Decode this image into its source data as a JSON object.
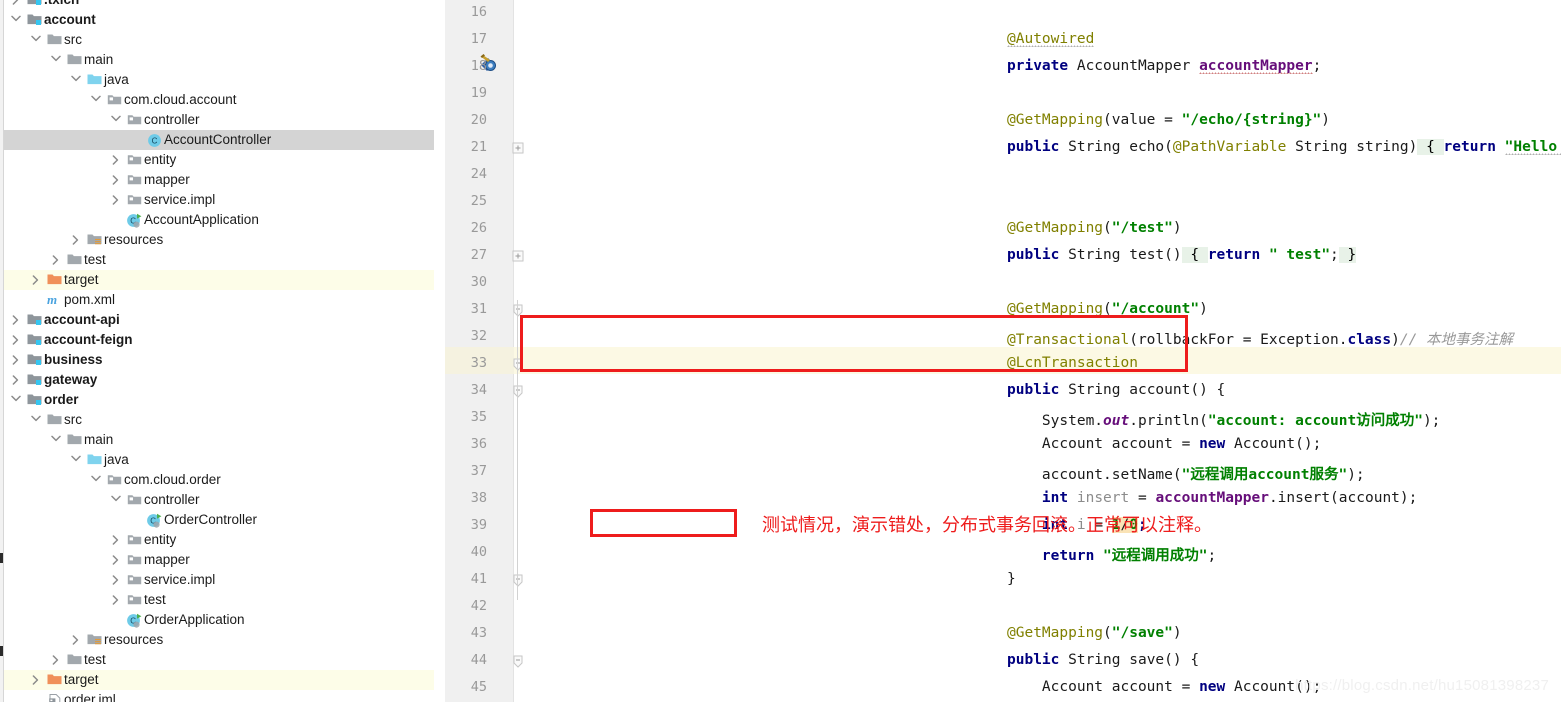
{
  "project_tree": {
    "name": "project-tool-window",
    "rows": [
      {
        "indent": 1,
        "arrow": "right",
        "icon": "folder-module",
        "label": ".txlcn",
        "bold": true,
        "state": "partial-top"
      },
      {
        "indent": 1,
        "arrow": "down",
        "icon": "folder-module",
        "label": "account",
        "bold": true
      },
      {
        "indent": 2,
        "arrow": "down",
        "icon": "folder",
        "label": "src"
      },
      {
        "indent": 3,
        "arrow": "down",
        "icon": "folder",
        "label": "main"
      },
      {
        "indent": 4,
        "arrow": "down",
        "icon": "folder-source",
        "label": "java"
      },
      {
        "indent": 5,
        "arrow": "down",
        "icon": "package",
        "label": "com.cloud.account"
      },
      {
        "indent": 6,
        "arrow": "down",
        "icon": "package",
        "label": "controller"
      },
      {
        "indent": 7,
        "arrow": "none",
        "icon": "class",
        "label": "AccountController",
        "selected": true
      },
      {
        "indent": 6,
        "arrow": "right",
        "icon": "package",
        "label": "entity"
      },
      {
        "indent": 6,
        "arrow": "right",
        "icon": "package",
        "label": "mapper"
      },
      {
        "indent": 6,
        "arrow": "right",
        "icon": "package",
        "label": "service.impl"
      },
      {
        "indent": 6,
        "arrow": "none",
        "icon": "class-run",
        "label": "AccountApplication"
      },
      {
        "indent": 4,
        "arrow": "right",
        "icon": "folder-resources",
        "label": "resources"
      },
      {
        "indent": 3,
        "arrow": "right",
        "icon": "folder",
        "label": "test"
      },
      {
        "indent": 2,
        "arrow": "right",
        "icon": "folder-target",
        "label": "target",
        "highlight": true
      },
      {
        "indent": 2,
        "arrow": "none",
        "icon": "maven",
        "label": "pom.xml"
      },
      {
        "indent": 1,
        "arrow": "right",
        "icon": "folder-module",
        "label": "account-api",
        "bold": true
      },
      {
        "indent": 1,
        "arrow": "right",
        "icon": "folder-module",
        "label": "account-feign",
        "bold": true
      },
      {
        "indent": 1,
        "arrow": "right",
        "icon": "folder-module",
        "label": "business",
        "bold": true
      },
      {
        "indent": 1,
        "arrow": "right",
        "icon": "folder-module",
        "label": "gateway",
        "bold": true
      },
      {
        "indent": 1,
        "arrow": "down",
        "icon": "folder-module",
        "label": "order",
        "bold": true
      },
      {
        "indent": 2,
        "arrow": "down",
        "icon": "folder",
        "label": "src"
      },
      {
        "indent": 3,
        "arrow": "down",
        "icon": "folder",
        "label": "main"
      },
      {
        "indent": 4,
        "arrow": "down",
        "icon": "folder-source",
        "label": "java"
      },
      {
        "indent": 5,
        "arrow": "down",
        "icon": "package",
        "label": "com.cloud.order"
      },
      {
        "indent": 6,
        "arrow": "down",
        "icon": "package",
        "label": "controller"
      },
      {
        "indent": 7,
        "arrow": "none",
        "icon": "class-run",
        "label": "OrderController"
      },
      {
        "indent": 6,
        "arrow": "right",
        "icon": "package",
        "label": "entity"
      },
      {
        "indent": 6,
        "arrow": "right",
        "icon": "package",
        "label": "mapper"
      },
      {
        "indent": 6,
        "arrow": "right",
        "icon": "package",
        "label": "service.impl"
      },
      {
        "indent": 6,
        "arrow": "right",
        "icon": "package",
        "label": "test"
      },
      {
        "indent": 6,
        "arrow": "none",
        "icon": "class-run",
        "label": "OrderApplication"
      },
      {
        "indent": 4,
        "arrow": "right",
        "icon": "folder-resources",
        "label": "resources"
      },
      {
        "indent": 3,
        "arrow": "right",
        "icon": "folder",
        "label": "test"
      },
      {
        "indent": 2,
        "arrow": "right",
        "icon": "folder-target",
        "label": "target",
        "highlight": true
      },
      {
        "indent": 2,
        "arrow": "none",
        "icon": "iml",
        "label": "order.iml"
      }
    ]
  },
  "editor": {
    "name": "code-editor",
    "gutter_line_numbers": [
      "16",
      "17",
      "18",
      "19",
      "20",
      "21",
      "24",
      "25",
      "26",
      "27",
      "30",
      "31",
      "32",
      "33",
      "34",
      "35",
      "36",
      "37",
      "38",
      "39",
      "40",
      "41",
      "42",
      "43",
      "44",
      "45"
    ],
    "bean_gutter_icon_line": "18",
    "caret_line": "33",
    "lines": {
      "16": "",
      "17": "    @Autowired",
      "18": "    private AccountMapper accountMapper;",
      "19": "",
      "20": "    @GetMapping(value = \"/echo/{string}\")",
      "21": "    public String echo(@PathVariable String string) { return \"Hello Nacos order \" + string; }",
      "24": "",
      "25": "",
      "26": "    @GetMapping(\"/test\")",
      "27": "    public String test() { return \" test\"; }",
      "30": "",
      "31": "    @GetMapping(\"/account\")",
      "32": "    @Transactional(rollbackFor = Exception.class)// 本地事务注解",
      "33": "    @LcnTransaction",
      "34": "    public String account() {",
      "35": "        System.out.println(\"account: account访问成功\");",
      "36": "        Account account = new Account();",
      "37": "        account.setName(\"远程调用account服务\");",
      "38": "        int insert = accountMapper.insert(account);",
      "39": "        int i = 1/0;",
      "40": "        return \"远程调用成功\";",
      "41": "    }",
      "42": "",
      "43": "    @GetMapping(\"/save\")",
      "44": "    public String save() {",
      "45": "        Account account = new Account();"
    }
  },
  "annotations": {
    "box_1_name": "red-highlight-box-transaction-annotations",
    "box_2_name": "red-highlight-box-divide-by-zero",
    "note_text": "测试情况，演示错处，分布式事务回滚。正常可以注释。",
    "note_color": "#ee1c1c"
  },
  "watermark": {
    "text": "https://blog.csdn.net/hu15081398237"
  },
  "colors": {
    "keyword": "#000080",
    "annotation": "#808000",
    "string": "#008000",
    "field": "#660e7a",
    "comment": "#999999",
    "red_accent": "#ee1c1c",
    "selection_bg": "#d4d4d4",
    "caret_line_bg": "#fcf9e4",
    "target_row_bg": "#fdfde8"
  }
}
